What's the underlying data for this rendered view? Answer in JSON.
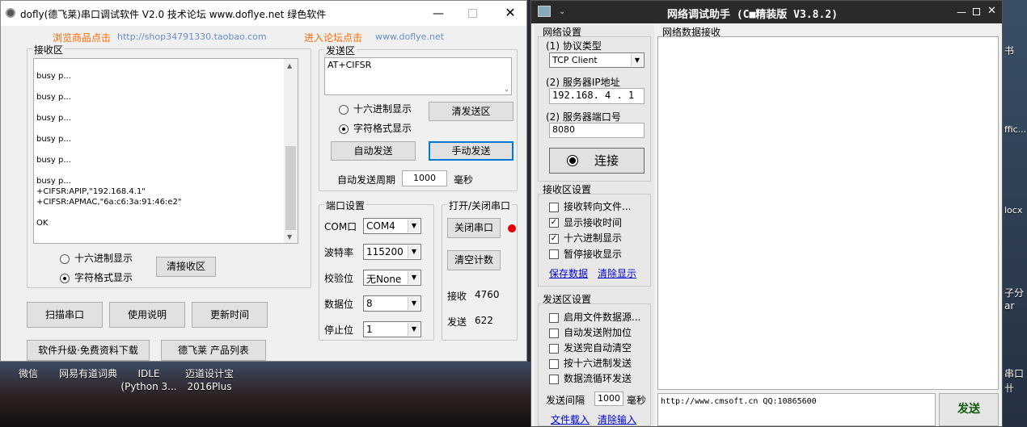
{
  "desktop": {
    "icons": [
      {
        "label": "微信"
      },
      {
        "label": "网易有道词典"
      },
      {
        "label": "IDLE (Python 3..."
      },
      {
        "label": "迈道设计宝 2016Plus"
      }
    ],
    "right_strip": [
      "书",
      "ffic...",
      "locx",
      "子分",
      "ar",
      "串口",
      "卄"
    ]
  },
  "dofly": {
    "title": "dofly(德飞莱)串口调试软件 V2.0 技术论坛 www.doflye.net 绿色软件",
    "link1_label": "浏览商品点击",
    "link1_url": "http://shop34791330.taobao.com",
    "link2_label": "进入论坛点击",
    "link2_url": "www.doflye.net",
    "recv": {
      "label": "接收区",
      "lines": [
        "",
        "busy p...",
        "",
        "busy p...",
        "",
        "busy p...",
        "",
        "busy p...",
        "",
        "busy p...",
        "",
        "busy p...",
        "+CIFSR:APIP,\"192.168.4.1\"",
        "+CIFSR:APMAC,\"6a:c6:3a:91:46:e2\"",
        "",
        "OK"
      ],
      "hex_label": "十六进制显示",
      "char_label": "字符格式显示",
      "clear_label": "清接收区"
    },
    "send": {
      "label": "发送区",
      "text": "AT+CIFSR",
      "hex_label": "十六进制显示",
      "char_label": "字符格式显示",
      "clear_label": "清发送区",
      "auto_label": "自动发送",
      "manual_label": "手动发送",
      "period_label": "自动发送周期",
      "period_value": "1000",
      "ms_label": "毫秒"
    },
    "port": {
      "label": "端口设置",
      "com_label": "COM口",
      "com_value": "COM4",
      "baud_label": "波特率",
      "baud_value": "115200",
      "parity_label": "校验位",
      "parity_value": "无None",
      "data_label": "数据位",
      "data_value": "8",
      "stop_label": "停止位",
      "stop_value": "1"
    },
    "openclose": {
      "label": "打开/关闭串口",
      "close_label": "关闭串口",
      "clear_count_label": "清空计数",
      "recv_label": "接收",
      "recv_count": "4760",
      "send_label": "发送",
      "send_count": "622",
      "status_color": "#e00000"
    },
    "buttons": {
      "scan": "扫描串口",
      "help": "使用说明",
      "time": "更新时间",
      "upgrade": "软件升级·免费资料下载",
      "products": "德飞莱 产品列表"
    }
  },
  "netassist": {
    "title": "网络调试助手 (C■精装版 V3.8.2)",
    "net_settings_label": "网络设置",
    "protocol_label": "(1) 协议类型",
    "protocol_value": "TCP Client",
    "ip_label": "(2) 服务器IP地址",
    "ip_value": "192.168. 4 . 1",
    "port_label": "(2) 服务器端口号",
    "port_value": "8080",
    "connect_label": "连接",
    "recv_settings_label": "接收区设置",
    "recv_options": [
      {
        "label": "接收转向文件...",
        "checked": false
      },
      {
        "label": "显示接收时间",
        "checked": true
      },
      {
        "label": "十六进制显示",
        "checked": true
      },
      {
        "label": "暂停接收显示",
        "checked": false
      }
    ],
    "save_data": "保存数据",
    "clear_display": "清除显示",
    "send_settings_label": "发送区设置",
    "send_options": [
      {
        "label": "启用文件数据源...",
        "checked": false
      },
      {
        "label": "自动发送附加位",
        "checked": false
      },
      {
        "label": "发送完自动清空",
        "checked": false
      },
      {
        "label": "按十六进制发送",
        "checked": false
      },
      {
        "label": "数据流循环发送",
        "checked": false
      }
    ],
    "interval_label": "发送间隔",
    "interval_value": "1000",
    "ms_label": "毫秒",
    "load_file": "文件载入",
    "clear_input": "清除输入",
    "recv_area_label": "网络数据接收",
    "send_text": "http://www.cmsoft.cn QQ:10865600",
    "send_button": "发送"
  }
}
